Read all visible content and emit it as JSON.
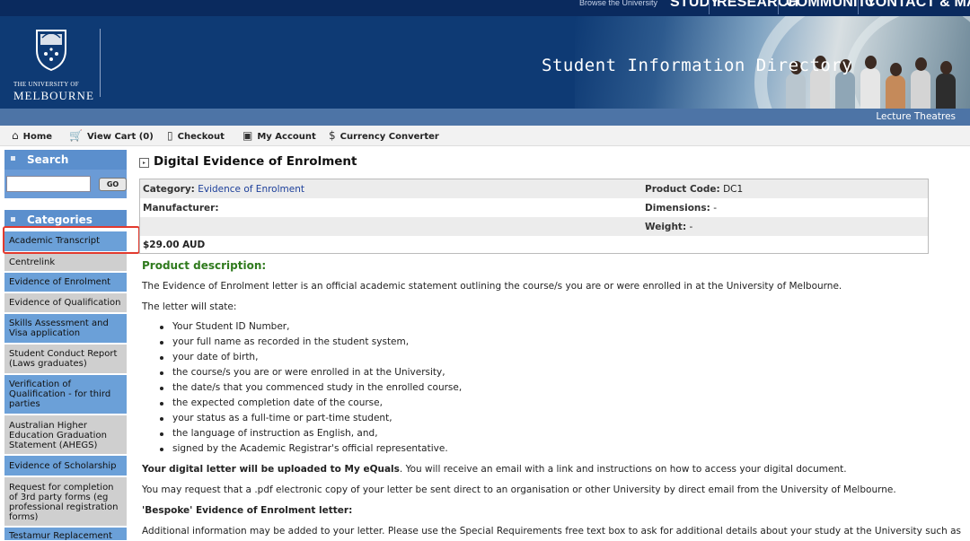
{
  "header": {
    "browse_label": "Browse the University",
    "nav": [
      "STUDY",
      "RESEARCH",
      "COMMUNITY",
      "CONTACT & MAPS"
    ],
    "logo_line1": "THE UNIVERSITY OF",
    "logo_line2": "MELBOURNE",
    "site_title": "Student Information Directory",
    "subbar_link": "Lecture Theatres"
  },
  "menu": {
    "home": "Home",
    "view_cart": "View Cart (0)",
    "checkout": "Checkout",
    "my_account": "My Account",
    "currency_converter": "Currency Converter"
  },
  "sidebar": {
    "search_title": "Search",
    "search_value": "",
    "go_label": "GO",
    "categories_title": "Categories",
    "categories": [
      "Academic Transcript",
      "Centrelink",
      "Evidence of Enrolment",
      "Evidence of Qualification",
      "Skills Assessment and Visa application",
      "Student Conduct Report (Laws graduates)",
      "Verification of Qualification - for third parties",
      "Australian Higher Education Graduation Statement (AHEGS)",
      "Evidence of Scholarship",
      "Request for completion of 3rd party forms (eg professional registration forms)",
      "Testamur Replacement"
    ]
  },
  "product": {
    "title": "Digital Evidence of Enrolment",
    "category_label": "Category:",
    "category_value": "Evidence of Enrolment",
    "product_code_label": "Product Code:",
    "product_code_value": "DC1",
    "manufacturer_label": "Manufacturer:",
    "dimensions_label": "Dimensions:",
    "dimensions_value": "-",
    "weight_label": "Weight:",
    "weight_value": "-",
    "price": "$29.00 AUD"
  },
  "description": {
    "heading": "Product description:",
    "p1": "The Evidence of Enrolment letter is an official academic statement outlining the course/s you are or were enrolled in at the University of Melbourne.",
    "p2": "The letter will state:",
    "bullets": [
      "Your Student ID Number,",
      "your full name as recorded in the student system,",
      "your date of birth,",
      "the course/s you are or were enrolled in at the University,",
      "the date/s that you commenced study in the enrolled course,",
      "the expected completion date of the course,",
      "your status as a full-time or part-time student,",
      "the language of instruction as English, and,",
      "signed by the Academic Registrar's official representative."
    ],
    "p3_bold": "Your digital letter will be uploaded to My eQuals",
    "p3_rest": ".  You will receive an email with a link and instructions on how to access your digital document.",
    "p4": "You may request that a .pdf electronic copy of your letter be sent direct to an organisation or other University by direct email from the University of Melbourne.",
    "p5_bold": "'Bespoke' Evidence of Enrolment letter:",
    "p6": "Additional information may be added to your letter.  Please use the Special Requirements free text box to ask for additional details about your study at the University such as"
  }
}
